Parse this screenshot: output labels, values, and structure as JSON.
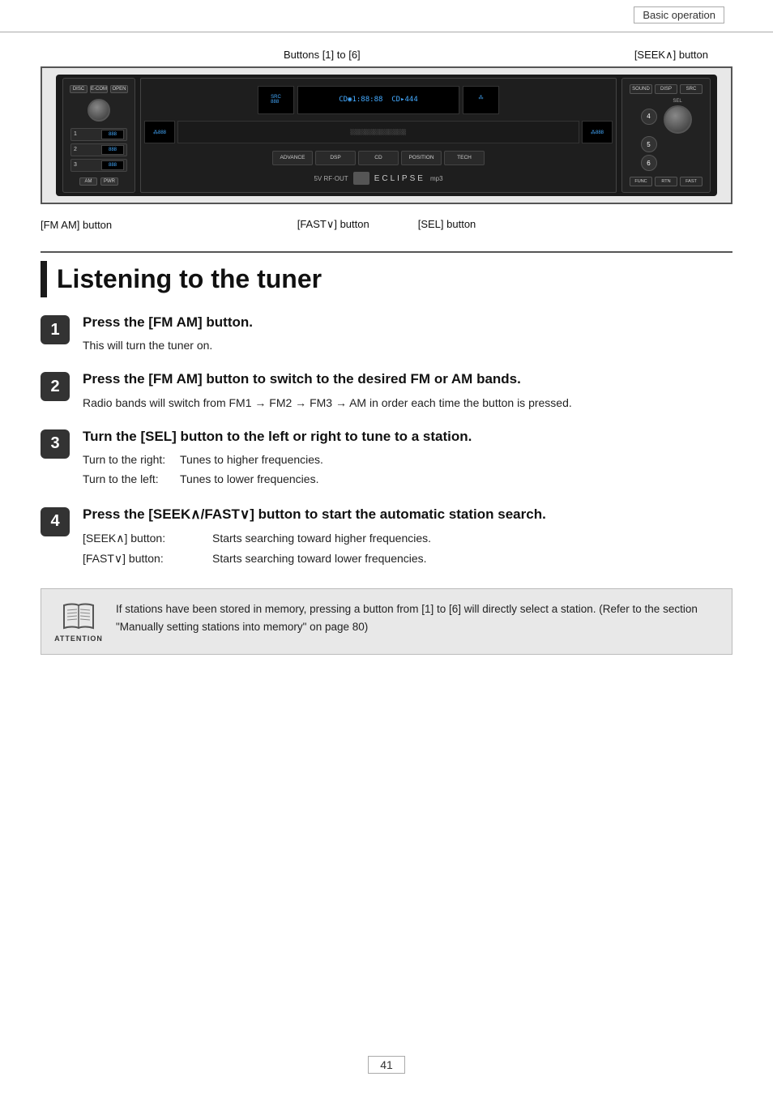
{
  "header": {
    "label": "Basic operation"
  },
  "diagram": {
    "label_top_center": "Buttons [1] to [6]",
    "label_top_right": "[SEEK∧] button",
    "label_bottom_left": "[FM AM] button",
    "label_bottom_center_1": "[FAST∨] button",
    "label_bottom_center_2": "[SEL] button"
  },
  "section": {
    "title": "Listening to the tuner"
  },
  "steps": [
    {
      "number": "1",
      "heading": "Press the [FM AM] button.",
      "description": "This will turn the tuner on."
    },
    {
      "number": "2",
      "heading": "Press the [FM AM] button to switch to the desired FM or AM bands.",
      "description": "Radio bands will switch from FM1 → FM2 → FM3 → AM in order each time the button is pressed."
    },
    {
      "number": "3",
      "heading": "Turn the [SEL] button to the left or right to tune to a station.",
      "turn_right_label": "Turn to the right:",
      "turn_right_value": "Tunes to higher frequencies.",
      "turn_left_label": "Turn to the left:",
      "turn_left_value": "Tunes to lower frequencies."
    },
    {
      "number": "4",
      "heading": "Press the [SEEK∧/FAST∨] button to start the automatic station search.",
      "seek_label": "[SEEK∧] button:",
      "seek_value": "Starts searching toward higher frequencies.",
      "fast_label": "[FAST∨] button:",
      "fast_value": "Starts searching toward lower frequencies."
    }
  ],
  "attention": {
    "text": "If stations have been stored in memory, pressing a button from [1] to [6] will directly select a station. (Refer to the section \"Manually setting stations into memory\" on page 80)"
  },
  "footer": {
    "page_number": "41"
  }
}
